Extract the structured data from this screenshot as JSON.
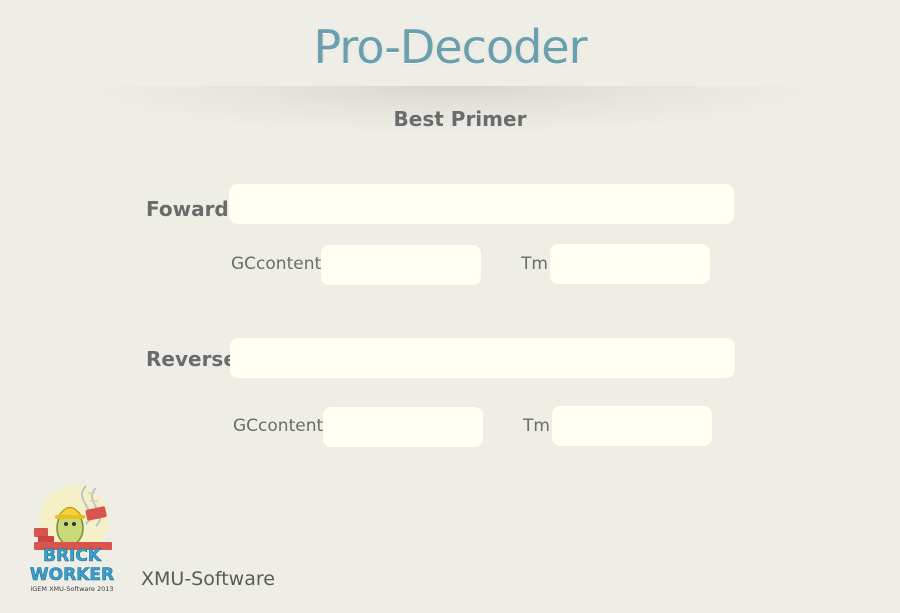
{
  "app_title": "Pro-Decoder",
  "section_title": "Best Primer",
  "forward": {
    "label": "Foward",
    "sequence_value": "",
    "gc_label": "GCcontent",
    "gc_value": "",
    "tm_label": "Tm",
    "tm_value": ""
  },
  "reverse": {
    "label": "Reverse",
    "sequence_value": "",
    "gc_label": "GCcontent",
    "gc_value": "",
    "tm_label": "Tm",
    "tm_value": ""
  },
  "logo": {
    "line1": "BRICK",
    "line2": "WORKER",
    "caption": "iGEM XMU-Software 2013",
    "colors": {
      "text": "#3aa0d0",
      "brick": "#d9544d",
      "helmet": "#f3d23b",
      "body": "#c9d97a"
    }
  },
  "footer": {
    "text": "XMU-Software"
  }
}
